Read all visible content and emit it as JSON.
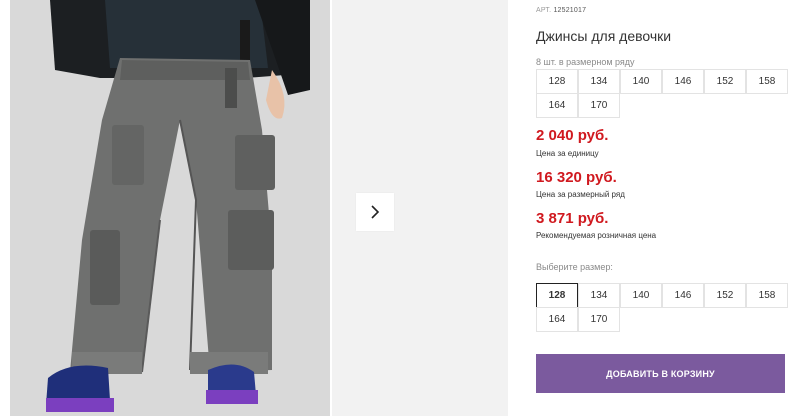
{
  "product": {
    "sku_label": "АРТ.",
    "sku_number": "12521017",
    "title": "Джинсы для девочки"
  },
  "size_run": {
    "label": "8 шт. в размерном ряду",
    "sizes": [
      "128",
      "134",
      "140",
      "146",
      "152",
      "158",
      "164",
      "170"
    ]
  },
  "prices": [
    {
      "value": "2 040 руб.",
      "caption": "Цена за единицу"
    },
    {
      "value": "16 320 руб.",
      "caption": "Цена за размерный ряд"
    },
    {
      "value": "3 871 руб.",
      "caption": "Рекомендуемая розничная цена"
    }
  ],
  "size_select": {
    "label": "Выберите размер:",
    "sizes": [
      "128",
      "134",
      "140",
      "146",
      "152",
      "158",
      "164",
      "170"
    ],
    "selected": "128"
  },
  "cart_button": {
    "label": "ДОБАВИТЬ В КОРЗИНУ"
  },
  "gallery": {
    "next_icon": "chevron-right-icon"
  },
  "colors": {
    "price": "#d0191f",
    "button": "#7b5a9e"
  }
}
